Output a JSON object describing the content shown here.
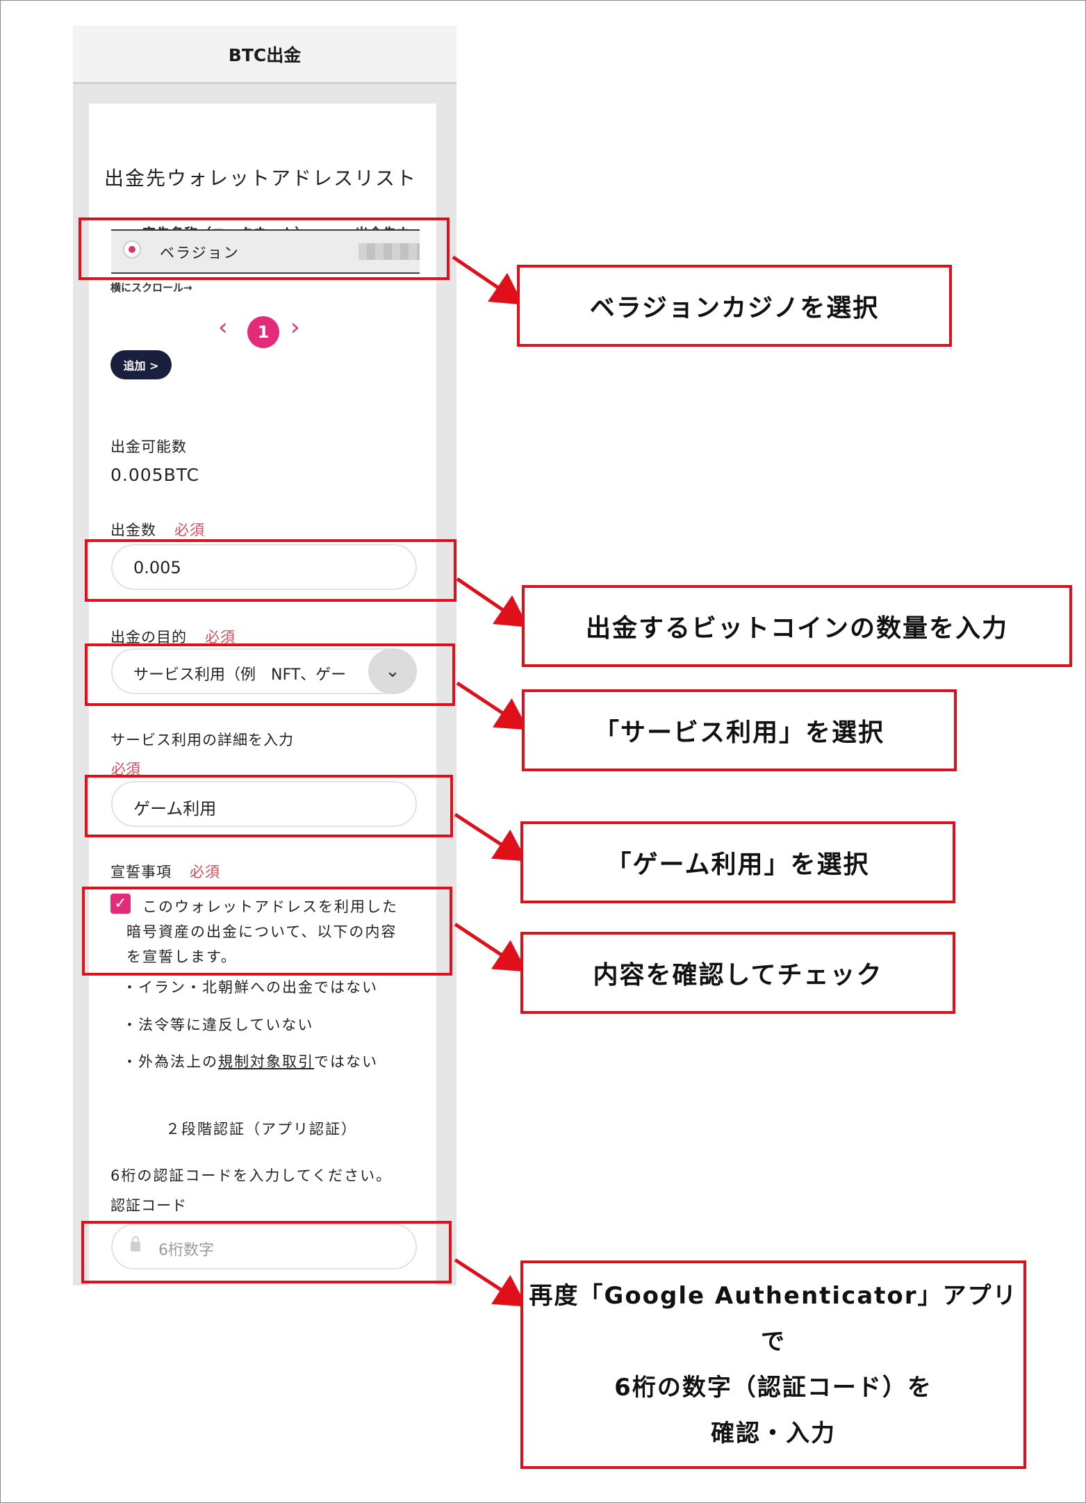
{
  "header": {
    "title": "BTC出金"
  },
  "wallet_list": {
    "title": "出金先ウォレットアドレスリスト",
    "col_nickname": "宛先名称（ニックネーム）",
    "col_address": "出金先ウ:",
    "row_name": "ベラジョン",
    "scroll_hint": "横にスクロール→",
    "page_current": "1",
    "prev_icon": "‹",
    "next_icon": "›",
    "add_button": "追加 >"
  },
  "available": {
    "label": "出金可能数",
    "value": "0.005BTC"
  },
  "amount": {
    "label": "出金数",
    "required": "必須",
    "value": "0.005"
  },
  "purpose": {
    "label": "出金の目的",
    "required": "必須",
    "value": "サービス利用（例　NFT、ゲー",
    "chevron": "⌄"
  },
  "detail": {
    "label": "サービス利用の詳細を入力",
    "required": "必須",
    "value": "ゲーム利用"
  },
  "declaration": {
    "label": "宣誓事項",
    "required": "必須",
    "checkbox_mark": "✓",
    "text_line1": "このウォレットアドレスを利用した",
    "text_line2": "暗号資産の出金について、以下の内容",
    "text_line3": "を宣誓します。",
    "item1": "・イラン・北朝鮮への出金ではない",
    "item2": "・法令等に違反していない",
    "item3_pre": "・外為法上の",
    "item3_link": "規制対象取引",
    "item3_post": "ではない"
  },
  "twofa": {
    "title": "２段階認証（アプリ認証）",
    "instruction": "6桁の認証コードを入力してください。",
    "code_label": "認証コード",
    "placeholder": "6桁数字"
  },
  "callouts": {
    "c1": "ベラジョンカジノを選択",
    "c2": "出金するビットコインの数量を入力",
    "c3": "「サービス利用」を選択",
    "c4": "「ゲーム利用」を選択",
    "c5": "内容を確認してチェック",
    "c6_line1": "再度「Google Authenticator」アプリで",
    "c6_line2": "6桁の数字（認証コード）を",
    "c6_line3": "確認・入力"
  },
  "colors": {
    "accent": "#e42b7a",
    "highlight": "#e0101a",
    "dark_button": "#1a1f3d",
    "required": "#d94a5a"
  }
}
